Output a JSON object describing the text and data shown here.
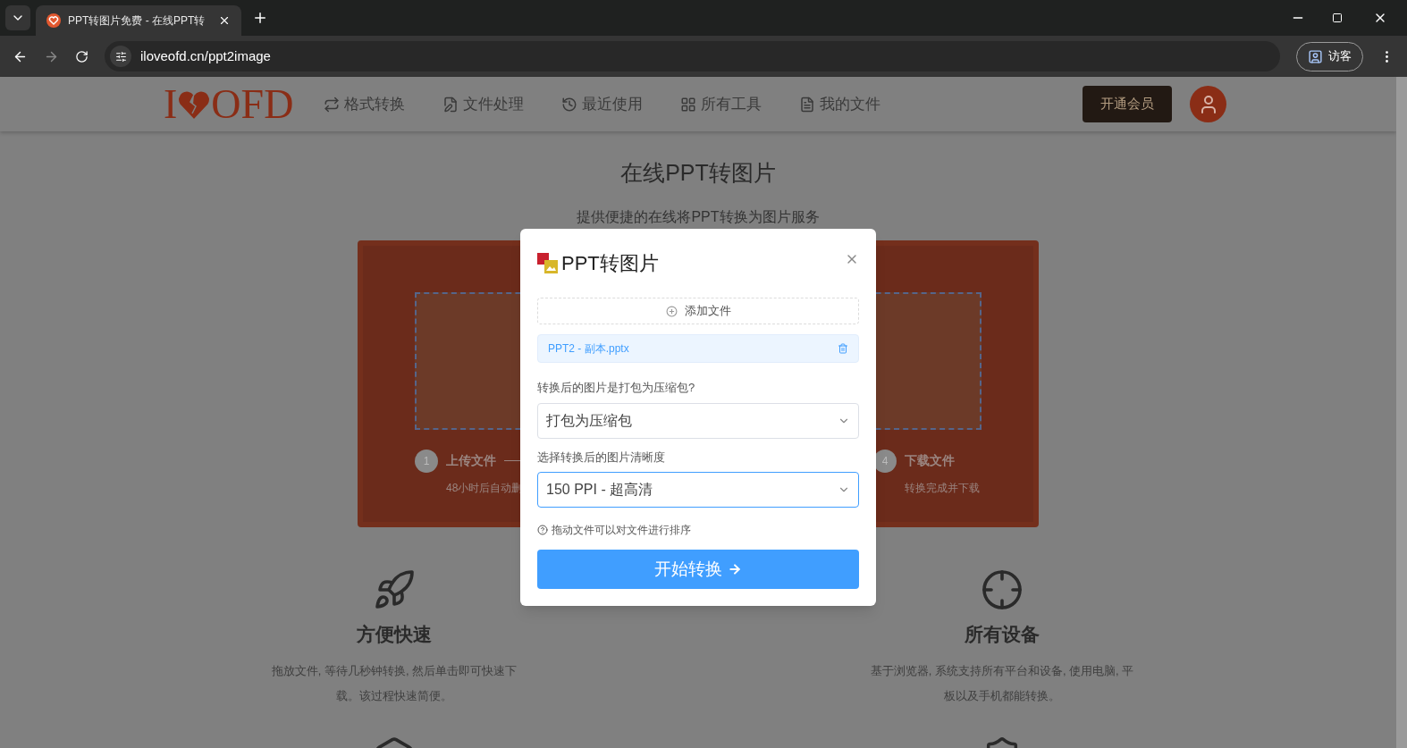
{
  "browser": {
    "tabs": [
      {
        "title": "PPT转图片免费 - 在线PPT转",
        "selected": true
      }
    ],
    "url": "iloveofd.cn/ppt2image",
    "profile_label": "访客"
  },
  "header": {
    "logo_left": "I",
    "logo_right": "OFD",
    "nav": [
      {
        "label": "格式转换",
        "kind": "convert"
      },
      {
        "label": "文件处理",
        "kind": "edit"
      },
      {
        "label": "最近使用",
        "kind": "recent"
      },
      {
        "label": "所有工具",
        "kind": "grid"
      },
      {
        "label": "我的文件",
        "kind": "file"
      }
    ],
    "member_button": "开通会员"
  },
  "hero": {
    "title": "在线PPT转图片",
    "subtitle": "提供便捷的在线将PPT转换为图片服务",
    "steps": [
      {
        "number": "1",
        "title": "上传文件",
        "note": "48小时后自动删"
      },
      {
        "number": "4",
        "title": "下载文件",
        "note": "转换完成并下载"
      }
    ]
  },
  "features": [
    {
      "kind": "rocket",
      "title": "方便快速",
      "text": "拖放文件, 等待几秒钟转换, 然后单击即可快速下载。该过程快速简便。"
    },
    {
      "kind": "target",
      "title": "所有设备",
      "text": "基于浏览器, 系统支持所有平台和设备, 使用电脑, 平板以及手机都能转换。"
    }
  ],
  "dialog": {
    "title": "PPT转图片",
    "add_file_button": "添加文件",
    "files": [
      {
        "name": "PPT2 - 副本.pptx"
      }
    ],
    "fields": [
      {
        "label": "转换后的图片是打包为压缩包?",
        "value": "打包为压缩包",
        "focused": false
      },
      {
        "label": "选择转换后的图片清晰度",
        "value": "150 PPI - 超高清",
        "focused": true
      }
    ],
    "hint": "拖动文件可以对文件进行排序",
    "submit_button": "开始转换"
  }
}
